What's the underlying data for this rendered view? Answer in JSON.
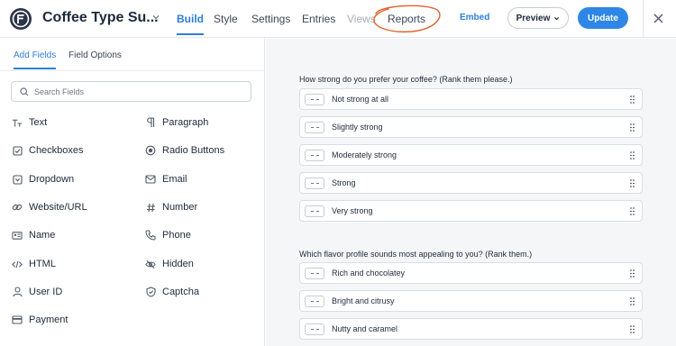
{
  "app": {
    "form_title": "Coffee Type Su...",
    "tabs": [
      {
        "label": "Build",
        "state": "active"
      },
      {
        "label": "Style",
        "state": "normal"
      },
      {
        "label": "Settings",
        "state": "normal"
      },
      {
        "label": "Entries",
        "state": "normal"
      },
      {
        "label": "Views",
        "state": "disabled"
      },
      {
        "label": "Reports",
        "state": "normal"
      }
    ],
    "embed_label": "Embed",
    "preview_label": "Preview",
    "update_label": "Update",
    "colors": {
      "accent": "#2e7fd9",
      "annotation": "#e0622c",
      "logo_bg": "#2c3447"
    }
  },
  "sidebar": {
    "subtabs": [
      {
        "label": "Add Fields",
        "active": true
      },
      {
        "label": "Field Options",
        "active": false
      }
    ],
    "search_placeholder": "Search Fields",
    "fields": [
      {
        "label": "Text",
        "icon": "text-icon"
      },
      {
        "label": "Paragraph",
        "icon": "paragraph-icon"
      },
      {
        "label": "Checkboxes",
        "icon": "checkbox-icon"
      },
      {
        "label": "Radio Buttons",
        "icon": "radio-icon"
      },
      {
        "label": "Dropdown",
        "icon": "dropdown-icon"
      },
      {
        "label": "Email",
        "icon": "email-icon"
      },
      {
        "label": "Website/URL",
        "icon": "link-icon"
      },
      {
        "label": "Number",
        "icon": "hash-icon"
      },
      {
        "label": "Name",
        "icon": "id-card-icon"
      },
      {
        "label": "Phone",
        "icon": "phone-icon"
      },
      {
        "label": "HTML",
        "icon": "code-icon"
      },
      {
        "label": "Hidden",
        "icon": "eye-slash-icon"
      },
      {
        "label": "User ID",
        "icon": "user-icon"
      },
      {
        "label": "Captcha",
        "icon": "shield-icon"
      },
      {
        "label": "Payment",
        "icon": "card-icon"
      }
    ]
  },
  "canvas": {
    "questions": [
      {
        "text": "How strong do you prefer your coffee? (Rank them please.)",
        "options": [
          "Not strong at all",
          "Slightly strong",
          "Moderately strong",
          "Strong",
          "Very strong"
        ]
      },
      {
        "text": "Which flavor profile sounds most appealing to you? (Rank them.)",
        "options": [
          "Rich and chocolatey",
          "Bright and citrusy",
          "Nutty and caramel"
        ]
      }
    ]
  }
}
